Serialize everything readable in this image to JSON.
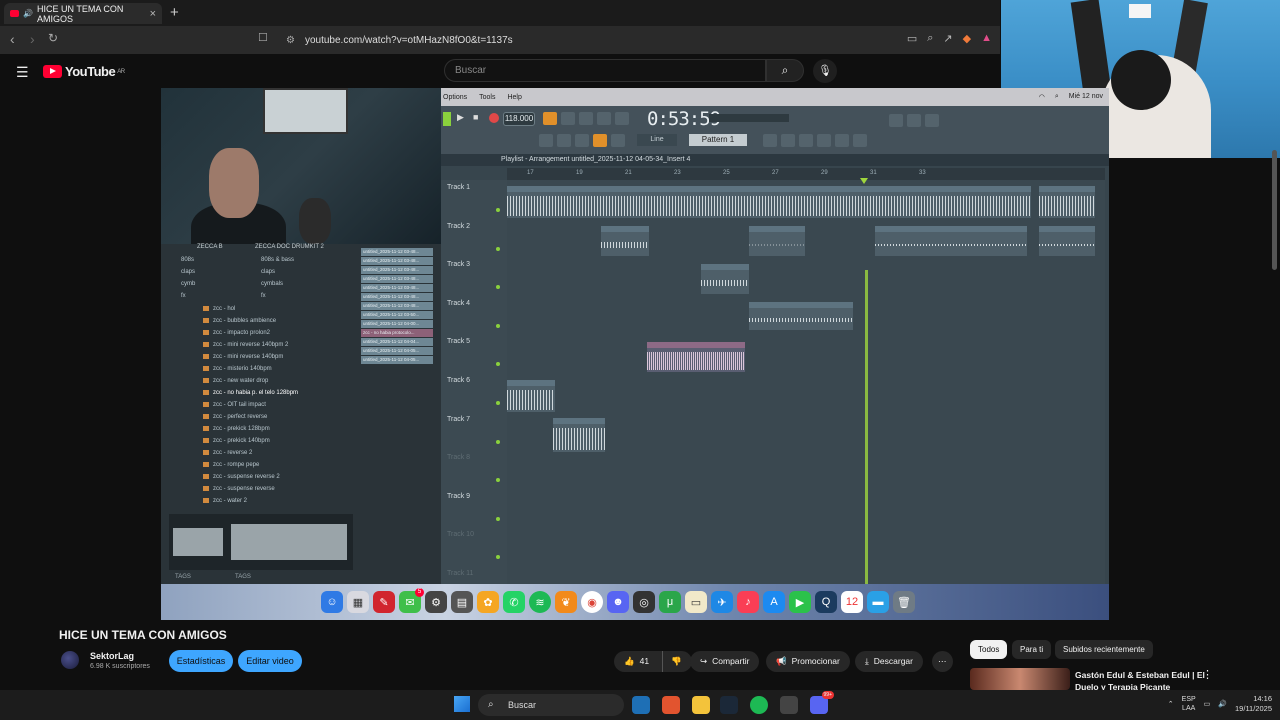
{
  "browser": {
    "tab_title": "HICE UN TEMA CON AMIGOS",
    "tab_close": "×",
    "new_tab": "+",
    "url": "youtube.com/watch?v=otMHazN8fO0&t=1137s"
  },
  "youtube": {
    "logo_text": "YouTube",
    "logo_region": "AR",
    "search_placeholder": "Buscar"
  },
  "video": {
    "fl_menu": [
      "Options",
      "Tools",
      "Help"
    ],
    "fl_menu_right": [
      "Mié 12 nov"
    ],
    "tempo": "118.000",
    "time": "0:53:59",
    "mode": "Line",
    "pattern": "Pattern 1",
    "playlist_title": "Playlist - Arrangement   untitled_2025-11-12 04-05-34_Insert 4",
    "browser_col1": "ZECCA B",
    "browser_col2": "ZECCA DOC DRUMKIT 2",
    "folders_left": [
      "808s",
      "claps",
      "cymb",
      "fx"
    ],
    "folders_right": [
      "808s & bass",
      "claps",
      "cymbals",
      "fx"
    ],
    "fx_items": [
      "zcc - hol",
      "zcc - bubbles ambience",
      "zcc - impacto prolon2",
      "zcc - mini reverse 140bpm 2",
      "zcc - mini reverse 140bpm",
      "zcc - misterio 140bpm",
      "zcc - new water drop",
      "zcc - no habia p. el telo 128bpm",
      "zcc - OIT tail impact",
      "zcc - perfect reverse",
      "zcc - prekick 128bpm",
      "zcc - prekick 140bpm",
      "zcc - reverse 2",
      "zcc - rompe pepe",
      "zcc - suspense reverse 2",
      "zcc - suspense reverse",
      "zcc - water 2"
    ],
    "selected_fx_index": 7,
    "patterns": [
      "untitled_2025-11-12 03-48...",
      "untitled_2025-11-12 03-48...",
      "untitled_2025-11-12 03-48...",
      "untitled_2025-11-12 03-48...",
      "untitled_2025-11-12 03-48...",
      "untitled_2025-11-12 03-48...",
      "untitled_2025-11-12 03-48...",
      "untitled_2025-11-12 03-50...",
      "untitled_2025-11-12 04-00...",
      "zcc - no habia protocolo...",
      "untitled_2025-11-12 04-04...",
      "untitled_2025-11-12 04-05...",
      "untitled_2025-11-12 04-05..."
    ],
    "tags_label": "TAGS",
    "tracks": [
      "Track 1",
      "Track 2",
      "Track 3",
      "Track 4",
      "Track 5",
      "Track 6",
      "Track 7",
      "Track 8",
      "Track 9",
      "Track 10",
      "Track 11"
    ],
    "clip_labels": {
      "track1": "Rochy RD Type Beat - Instrumental De Dembow  Pista de Dembow Dominicano - MelodicalMC",
      "track2a": "untitled_Insert 4",
      "track2b": "untitled_Insert 4",
      "track2c": "untitled_2025-11-12 04-05-34_Insert 4",
      "track2d": "untitled",
      "track3": "untitled_Insert 4",
      "track4": "untitled_2025-11-...04-05-06_Insert 4",
      "track5": "zcc - no habia pro...o el telo 128bpm",
      "track6": "untitled_Insert 4",
      "track7": "untitled_Insert 4"
    },
    "ruler": [
      "17",
      "19",
      "21",
      "23",
      "25",
      "27",
      "29",
      "31",
      "33"
    ],
    "dock_badge": "5"
  },
  "below": {
    "title": "HICE UN TEMA CON AMIGOS",
    "channel": "SektorLag",
    "subs": "6.98 K suscriptores",
    "btn_stats": "Estadísticas",
    "btn_edit": "Editar video",
    "likes": "41",
    "share": "Compartir",
    "promote": "Promocionar",
    "download": "Descargar",
    "chips": [
      "Todos",
      "Para ti",
      "Subidos recientemente"
    ],
    "suggest_title": "Gastón Edul & Esteban Edul | El Duelo y Terapia Picante"
  },
  "taskbar": {
    "search": "Buscar",
    "lang1": "ESP",
    "lang2": "LAA",
    "time": "14:16",
    "date": "19/11/2025",
    "notif_badge": "99+"
  },
  "colors": {
    "yt_red": "#ff0033",
    "blue_btn": "#3ea6ff",
    "fl_orange": "#e1902a",
    "playhead": "#9fd63d"
  }
}
